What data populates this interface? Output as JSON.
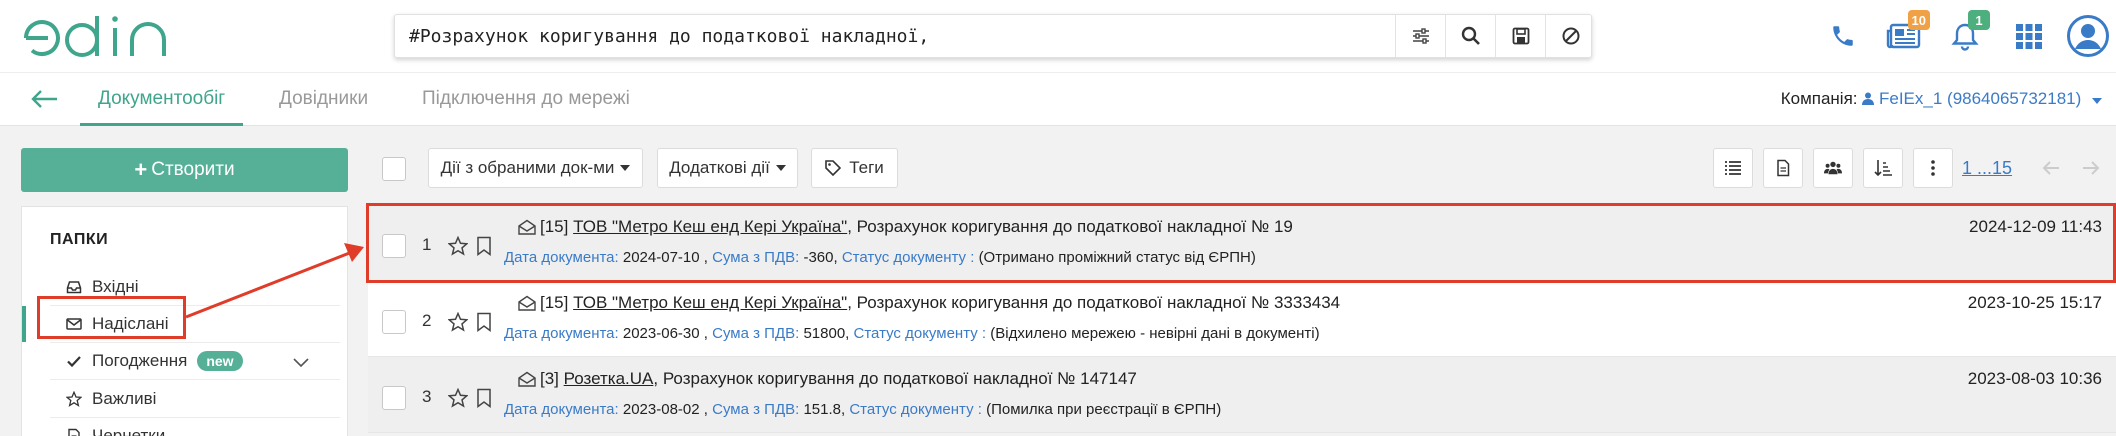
{
  "header": {
    "logo_text": "edin",
    "search_value": "#Розрахунок коригування до податкової накладної,",
    "search_buttons": [
      "filter-sliders-icon",
      "search-icon",
      "save-icon",
      "clear-icon"
    ],
    "icons": {
      "phone": "phone-icon",
      "news": {
        "icon": "newspaper-icon",
        "count": "10"
      },
      "notifications": {
        "icon": "bell-icon",
        "count": "1"
      },
      "apps": "grid-icon",
      "user": "user-avatar-icon"
    }
  },
  "nav": {
    "tabs": [
      {
        "label": "Документообіг",
        "active": true
      },
      {
        "label": "Довідники",
        "active": false
      },
      {
        "label": "Підключення до мережі",
        "active": false
      }
    ],
    "company_label": "Компанія:",
    "company_value": "FeIEx_1 (9864065732181)"
  },
  "sidebar": {
    "create_label": "Створити",
    "folders_title": "ПАПКИ",
    "folders": [
      {
        "label": "Вхідні",
        "icon": "inbox-icon"
      },
      {
        "label": "Надіслані",
        "icon": "envelope-icon",
        "active": true
      },
      {
        "label": "Погодження",
        "icon": "check-icon",
        "badge": "new"
      },
      {
        "label": "Важливі",
        "icon": "star-icon"
      },
      {
        "label": "Чернетки",
        "icon": "draft-icon"
      }
    ]
  },
  "toolbar": {
    "bulk_actions": "Дії з обраними док-ми",
    "extra_actions": "Додаткові дії",
    "tags": "Теги",
    "pager": "1 ...15"
  },
  "documents": [
    {
      "num": "1",
      "count": "[15]",
      "org": "ТОВ \"Метро Кеш енд Кері Україна\"",
      "title": ", Розрахунок коригування до податкової накладної № 19",
      "date_label": "Дата документа:",
      "date": "2024-07-10 ,",
      "sum_label": "Сума з ПДВ:",
      "sum": "-360,",
      "status_label": "Статус документу :",
      "status": "(Отримано проміжний статус від ЄРПН)",
      "timestamp": "2024-12-09 11:43"
    },
    {
      "num": "2",
      "count": "[15]",
      "org": "ТОВ \"Метро Кеш енд Кері Україна\"",
      "title": ", Розрахунок коригування до податкової накладної № 3333434",
      "date_label": "Дата документа:",
      "date": "2023-06-30 ,",
      "sum_label": "Сума з ПДВ:",
      "sum": "51800,",
      "status_label": "Статус документу :",
      "status": "(Відхилено мережею - невірні дані в документі)",
      "timestamp": "2023-10-25 15:17"
    },
    {
      "num": "3",
      "count": "[3]",
      "org": "Розетка.UA",
      "title": ", Розрахунок коригування до податкової накладної № 147147",
      "date_label": "Дата документа:",
      "date": "2023-08-02 ,",
      "sum_label": "Сума з ПДВ:",
      "sum": "151.8,",
      "status_label": "Статус документу :",
      "status": "(Помилка при реєстрації в ЄРПН)",
      "timestamp": "2023-08-03 10:36"
    }
  ],
  "colors": {
    "accent": "#3fa58c",
    "button": "#55b097",
    "link": "#3a7bc8",
    "annotation": "#e03c2a",
    "badge_orange": "#f0a045",
    "badge_green": "#4caf7d"
  }
}
